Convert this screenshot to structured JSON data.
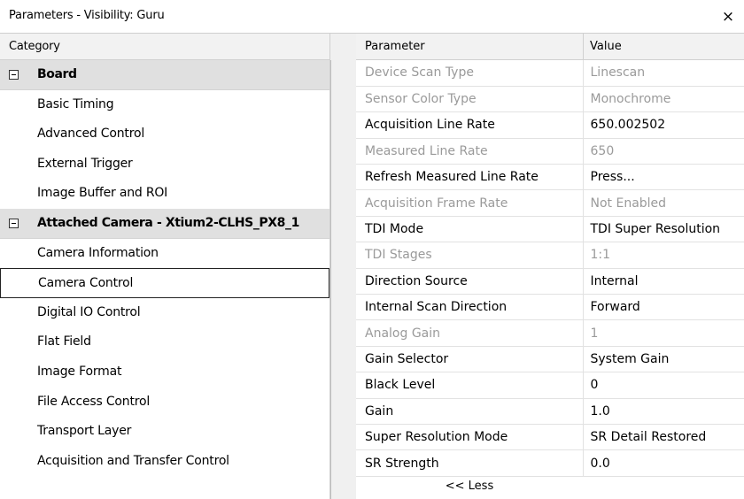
{
  "window": {
    "title": "Parameters - Visibility: Guru",
    "close_glyph": "×"
  },
  "left": {
    "header": "Category",
    "rows": [
      {
        "kind": "group",
        "label": "Board"
      },
      {
        "kind": "item",
        "label": "Basic Timing"
      },
      {
        "kind": "item",
        "label": "Advanced Control"
      },
      {
        "kind": "item",
        "label": "External Trigger"
      },
      {
        "kind": "item",
        "label": "Image Buffer and ROI"
      },
      {
        "kind": "group",
        "label": "Attached Camera - Xtium2-CLHS_PX8_1"
      },
      {
        "kind": "item",
        "label": "Camera Information"
      },
      {
        "kind": "item",
        "label": "Camera Control",
        "selected": true
      },
      {
        "kind": "item",
        "label": "Digital IO Control"
      },
      {
        "kind": "item",
        "label": "Flat Field"
      },
      {
        "kind": "item",
        "label": "Image Format"
      },
      {
        "kind": "item",
        "label": "File Access Control"
      },
      {
        "kind": "item",
        "label": "Transport Layer"
      },
      {
        "kind": "item",
        "label": "Acquisition and Transfer Control"
      }
    ]
  },
  "right": {
    "header_parameter": "Parameter",
    "header_value": "Value",
    "rows": [
      {
        "name": "Device Scan Type",
        "value": "Linescan",
        "disabled": true
      },
      {
        "name": "Sensor Color Type",
        "value": "Monochrome",
        "disabled": true
      },
      {
        "name": "Acquisition Line Rate",
        "value": "650.002502",
        "disabled": false
      },
      {
        "name": "Measured Line Rate",
        "value": "650",
        "disabled": true
      },
      {
        "name": "Refresh Measured Line Rate",
        "value": "Press...",
        "disabled": false
      },
      {
        "name": "Acquisition Frame Rate",
        "value": "Not Enabled",
        "disabled": true
      },
      {
        "name": "TDI Mode",
        "value": "TDI Super Resolution",
        "disabled": false
      },
      {
        "name": "TDI Stages",
        "value": "1:1",
        "disabled": true
      },
      {
        "name": "Direction Source",
        "value": "Internal",
        "disabled": false
      },
      {
        "name": "Internal Scan Direction",
        "value": "Forward",
        "disabled": false
      },
      {
        "name": "Analog Gain",
        "value": "1",
        "disabled": true
      },
      {
        "name": "Gain Selector",
        "value": "System Gain",
        "disabled": false
      },
      {
        "name": "Black Level",
        "value": "0",
        "disabled": false
      },
      {
        "name": "Gain",
        "value": "1.0",
        "disabled": false
      },
      {
        "name": "Super Resolution Mode",
        "value": "SR Detail Restored",
        "disabled": false
      },
      {
        "name": "SR Strength",
        "value": "0.0",
        "disabled": false
      }
    ],
    "less_label": "<< Less"
  }
}
